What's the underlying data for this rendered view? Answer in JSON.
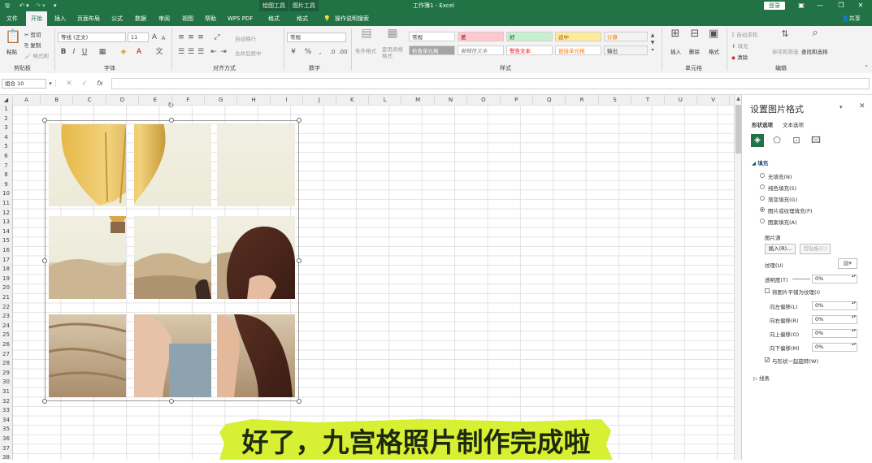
{
  "titlebar": {
    "title": "工作簿1 - Excel",
    "context_tab_drawing": "绘图工具",
    "context_tab_picture": "图片工具",
    "signin": "登录",
    "share": "共享"
  },
  "tabs": [
    "文件",
    "开始",
    "插入",
    "页面布局",
    "公式",
    "数据",
    "审阅",
    "视图",
    "帮助",
    "WPS PDF",
    "格式",
    "格式"
  ],
  "active_tab": "开始",
  "tell_me": "操作说明搜索",
  "ribbon": {
    "clipboard": {
      "paste": "粘贴",
      "cut": "剪切",
      "copy": "复制",
      "format_painter": "格式刷",
      "label": "剪贴板"
    },
    "font": {
      "name": "等线 (正文)",
      "size": "11",
      "label": "字体"
    },
    "alignment": {
      "wrap": "自动换行",
      "merge": "合并后居中",
      "label": "对齐方式"
    },
    "number": {
      "format": "常规",
      "label": "数字"
    },
    "styles": {
      "conditional": "条件格式",
      "table_format": "套用表格格式",
      "cells": [
        {
          "text": "常规",
          "bg": "#ffffff",
          "fg": "#333333"
        },
        {
          "text": "差",
          "bg": "#ffc7ce",
          "fg": "#9c0006"
        },
        {
          "text": "好",
          "bg": "#c6efce",
          "fg": "#006100"
        },
        {
          "text": "适中",
          "bg": "#ffeb9c",
          "fg": "#9c5700"
        },
        {
          "text": "计算",
          "bg": "#f2f2f2",
          "fg": "#fa7d00"
        },
        {
          "text": "检查单元格",
          "bg": "#a5a5a5",
          "fg": "#ffffff"
        },
        {
          "text": "解释性文本",
          "bg": "#ffffff",
          "fg": "#7f7f7f"
        },
        {
          "text": "警告文本",
          "bg": "#ffffff",
          "fg": "#ff0000"
        },
        {
          "text": "链接单元格",
          "bg": "#ffffff",
          "fg": "#fa7d00"
        },
        {
          "text": "输出",
          "bg": "#f2f2f2",
          "fg": "#3f3f3f"
        }
      ],
      "label": "样式"
    },
    "cells": {
      "insert": "插入",
      "delete": "删除",
      "format": "格式",
      "label": "单元格"
    },
    "editing": {
      "autosum": "自动求和",
      "fill": "填充",
      "clear": "清除",
      "sort": "排序和筛选",
      "find": "查找和选择",
      "label": "编辑"
    }
  },
  "formula_bar": {
    "name_box": "组合 10",
    "fx": "fx",
    "content": ""
  },
  "columns": [
    "A",
    "B",
    "C",
    "D",
    "E",
    "F",
    "G",
    "H",
    "I",
    "J",
    "K",
    "L",
    "M",
    "N",
    "O",
    "P",
    "Q",
    "R",
    "S",
    "T",
    "U",
    "V"
  ],
  "rows": [
    "1",
    "2",
    "3",
    "4",
    "5",
    "6",
    "7",
    "8",
    "9",
    "10",
    "11",
    "12",
    "13",
    "14",
    "15",
    "16",
    "17",
    "18",
    "19",
    "20",
    "21",
    "22",
    "23",
    "24",
    "25",
    "26",
    "27",
    "28",
    "29",
    "30",
    "31",
    "32",
    "33",
    "34",
    "35",
    "36",
    "37",
    "38"
  ],
  "pane": {
    "title": "设置图片格式",
    "tab_shape": "形状选项",
    "tab_text": "文本选项",
    "section_fill": "填充",
    "fill_options": [
      "无填充(N)",
      "纯色填充(S)",
      "渐变填充(G)",
      "图片或纹理填充(P)",
      "图案填充(A)"
    ],
    "selected_fill": "图片或纹理填充(P)",
    "picture_source": "图片源",
    "insert_btn": "插入(R)...",
    "clipboard_btn": "剪贴板(C)",
    "texture": "纹理(U)",
    "transparency": "透明度(T)",
    "transparency_value": "0%",
    "tile_picture": "将图片平铺为纹理(I)",
    "offset_left": "向左偏移(L)",
    "offset_right": "向右偏移(R)",
    "offset_top": "向上偏移(O)",
    "offset_bottom": "向下偏移(M)",
    "offset_left_value": "0%",
    "offset_right_value": "0%",
    "offset_top_value": "0%",
    "offset_bottom_value": "0%",
    "rotate_with_shape": "与形状一起旋转(W)",
    "section_line": "线条"
  },
  "caption": "好了，九宫格照片制作完成啦"
}
